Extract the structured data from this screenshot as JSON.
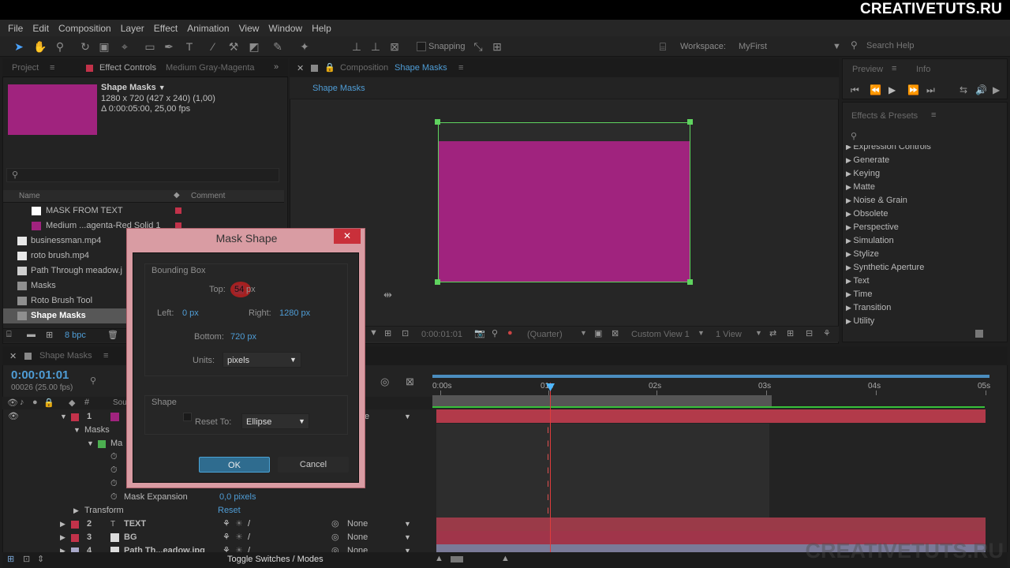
{
  "watermark": "CREATIVETUTS.RU",
  "menu": [
    "File",
    "Edit",
    "Composition",
    "Layer",
    "Effect",
    "Animation",
    "View",
    "Window",
    "Help"
  ],
  "toolbar": {
    "snapping_label": "Snapping",
    "workspace_label": "Workspace:",
    "workspace_value": "MyFirst",
    "search_placeholder": "Search Help"
  },
  "project_panel": {
    "tab_project": "Project",
    "tab_effect_controls": "Effect Controls",
    "effect_controls_target": "Medium Gray-Magenta",
    "comp_name": "Shape Masks",
    "comp_info_1": "1280 x 720  (427 x 240) (1,00)",
    "comp_info_2": "Δ 0:00:05:00, 25,00 fps",
    "col_name": "Name",
    "col_comment": "Comment",
    "items": [
      {
        "label": "MASK FROM TEXT"
      },
      {
        "label": "Medium ...agenta-Red Solid 1"
      },
      {
        "label": "businessman.mp4"
      },
      {
        "label": "roto brush.mp4"
      },
      {
        "label": "Path Through meadow.j"
      },
      {
        "label": "Masks"
      },
      {
        "label": "Roto Brush Tool"
      },
      {
        "label": "Shape Masks"
      }
    ],
    "bpc": "8 bpc"
  },
  "composition_panel": {
    "tab_label": "Composition",
    "tab_name": "Shape Masks",
    "breadcrumb": "Shape Masks",
    "timecode": "0:00:01:01",
    "resolution": "(Quarter)",
    "view": "Custom View 1",
    "views_count": "1 View"
  },
  "effects_panel": {
    "tab_preview": "Preview",
    "tab_info": "Info",
    "tab_effects": "Effects & Presets",
    "categories": [
      "Expression Controls",
      "Generate",
      "Keying",
      "Matte",
      "Noise & Grain",
      "Obsolete",
      "Perspective",
      "Simulation",
      "Stylize",
      "Synthetic Aperture",
      "Text",
      "Time",
      "Transition",
      "Utility"
    ]
  },
  "timeline": {
    "tab_name": "Shape Masks",
    "timecode": "0:00:01:01",
    "frame_info": "00026 (25.00 fps)",
    "ruler_labels": [
      "0:00s",
      "01s",
      "02s",
      "03s",
      "04s",
      "05s"
    ],
    "source_header": "Sou",
    "layer1_num": "1",
    "masks_label": "Masks",
    "mask_item": "Ma",
    "mask_expansion_label": "Mask Expansion",
    "mask_expansion_value": "0,0 pixels",
    "transform_label": "Transform",
    "transform_reset": "Reset",
    "layers": [
      {
        "num": "2",
        "name": "TEXT",
        "parent": "None"
      },
      {
        "num": "3",
        "name": "BG",
        "parent": "None"
      },
      {
        "num": "4",
        "name": "Path Th...eadow.jpg",
        "parent": "None"
      }
    ],
    "layer1_parent_partial": "e",
    "toggle_label": "Toggle Switches / Modes"
  },
  "dialog": {
    "title": "Mask Shape",
    "bounding_box_label": "Bounding Box",
    "top_label": "Top:",
    "top_value": "54",
    "unit_px": "px",
    "left_label": "Left:",
    "left_value": "0 px",
    "right_label": "Right:",
    "right_value": "1280 px",
    "bottom_label": "Bottom:",
    "bottom_value": "720 px",
    "units_label": "Units:",
    "units_value": "pixels",
    "shape_label": "Shape",
    "reset_to_label": "Reset To:",
    "reset_to_value": "Ellipse",
    "ok": "OK",
    "cancel": "Cancel"
  },
  "colors": {
    "solid": "#a0237e",
    "accent_blue": "#4f9dd6",
    "layer_red": "#c2324a",
    "dialog_frame": "#d99ca3"
  }
}
